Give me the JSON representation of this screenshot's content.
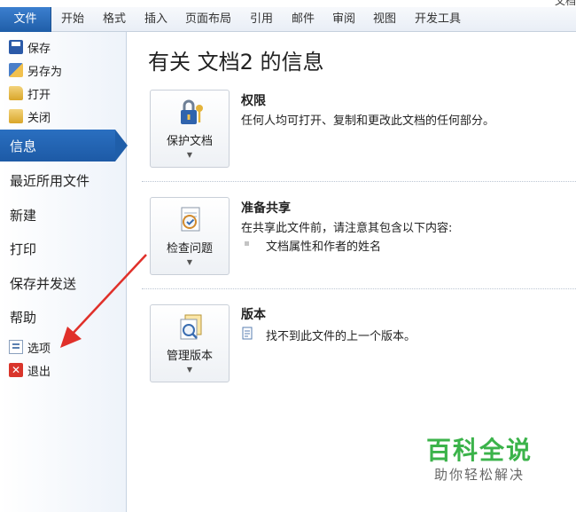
{
  "window": {
    "title_remnant": "文档"
  },
  "ribbon": {
    "tabs": [
      {
        "label": "文件"
      },
      {
        "label": "开始"
      },
      {
        "label": "格式"
      },
      {
        "label": "插入"
      },
      {
        "label": "页面布局"
      },
      {
        "label": "引用"
      },
      {
        "label": "邮件"
      },
      {
        "label": "审阅"
      },
      {
        "label": "视图"
      },
      {
        "label": "开发工具"
      }
    ]
  },
  "sidebar": {
    "small_top": [
      {
        "label": "保存",
        "icon": "save-icon"
      },
      {
        "label": "另存为",
        "icon": "save-as-icon"
      },
      {
        "label": "打开",
        "icon": "open-folder-icon"
      },
      {
        "label": "关闭",
        "icon": "close-folder-icon"
      }
    ],
    "big": [
      {
        "label": "信息"
      },
      {
        "label": "最近所用文件"
      },
      {
        "label": "新建"
      },
      {
        "label": "打印"
      },
      {
        "label": "保存并发送"
      },
      {
        "label": "帮助"
      }
    ],
    "small_bottom": [
      {
        "label": "选项",
        "icon": "options-icon"
      },
      {
        "label": "退出",
        "icon": "exit-icon"
      }
    ]
  },
  "main": {
    "title": "有关 文档2 的信息",
    "sections": [
      {
        "button_label": "保护文档",
        "title": "权限",
        "desc": "任何人均可打开、复制和更改此文档的任何部分。"
      },
      {
        "button_label": "检查问题",
        "title": "准备共享",
        "desc": "在共享此文件前，请注意其包含以下内容:",
        "bullet": "文档属性和作者的姓名"
      },
      {
        "button_label": "管理版本",
        "title": "版本",
        "desc": "找不到此文件的上一个版本。"
      }
    ]
  },
  "watermark": {
    "title": "百科全说",
    "subtitle": "助你轻松解决"
  },
  "colors": {
    "accent": "#1f5ea8",
    "arrow": "#e0302a",
    "watermark_green": "#3bb34a"
  }
}
